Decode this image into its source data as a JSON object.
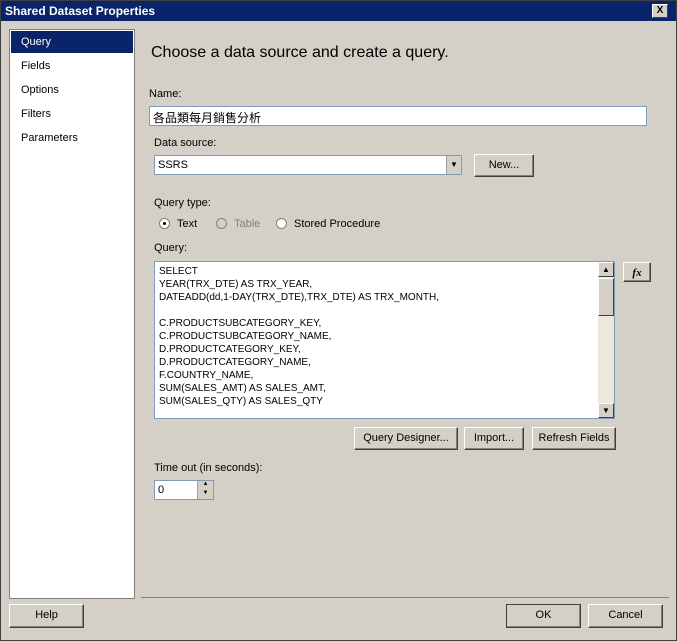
{
  "window": {
    "title": "Shared Dataset Properties",
    "close_label": "X"
  },
  "sidebar": {
    "items": [
      {
        "label": "Query"
      },
      {
        "label": "Fields"
      },
      {
        "label": "Options"
      },
      {
        "label": "Filters"
      },
      {
        "label": "Parameters"
      }
    ]
  },
  "main": {
    "heading": "Choose a data source and create a query.",
    "name_label": "Name:",
    "name_value": "各品類每月銷售分析",
    "data_source_label": "Data source:",
    "data_source_value": "SSRS",
    "new_button": "New...",
    "query_type_label": "Query type:",
    "query_types": [
      {
        "label": "Text",
        "selected": true,
        "enabled": true
      },
      {
        "label": "Table",
        "selected": false,
        "enabled": false
      },
      {
        "label": "Stored Procedure",
        "selected": false,
        "enabled": true
      }
    ],
    "query_label": "Query:",
    "query_lines": [
      "SELECT",
      "YEAR(TRX_DTE) AS TRX_YEAR,",
      "DATEADD(dd,1-DAY(TRX_DTE),TRX_DTE) AS TRX_MONTH,",
      "",
      "C.PRODUCTSUBCATEGORY_KEY,",
      "C.PRODUCTSUBCATEGORY_NAME,",
      "D.PRODUCTCATEGORY_KEY,",
      "D.PRODUCTCATEGORY_NAME,",
      "F.COUNTRY_NAME,",
      "SUM(SALES_AMT) AS SALES_AMT,",
      "SUM(SALES_QTY) AS SALES_QTY"
    ],
    "fx_button": "fx",
    "query_designer_button": "Query Designer...",
    "import_button": "Import...",
    "refresh_fields_button": "Refresh Fields",
    "timeout_label": "Time out (in seconds):",
    "timeout_value": "0"
  },
  "footer": {
    "help_button": "Help",
    "ok_button": "OK",
    "cancel_button": "Cancel"
  }
}
